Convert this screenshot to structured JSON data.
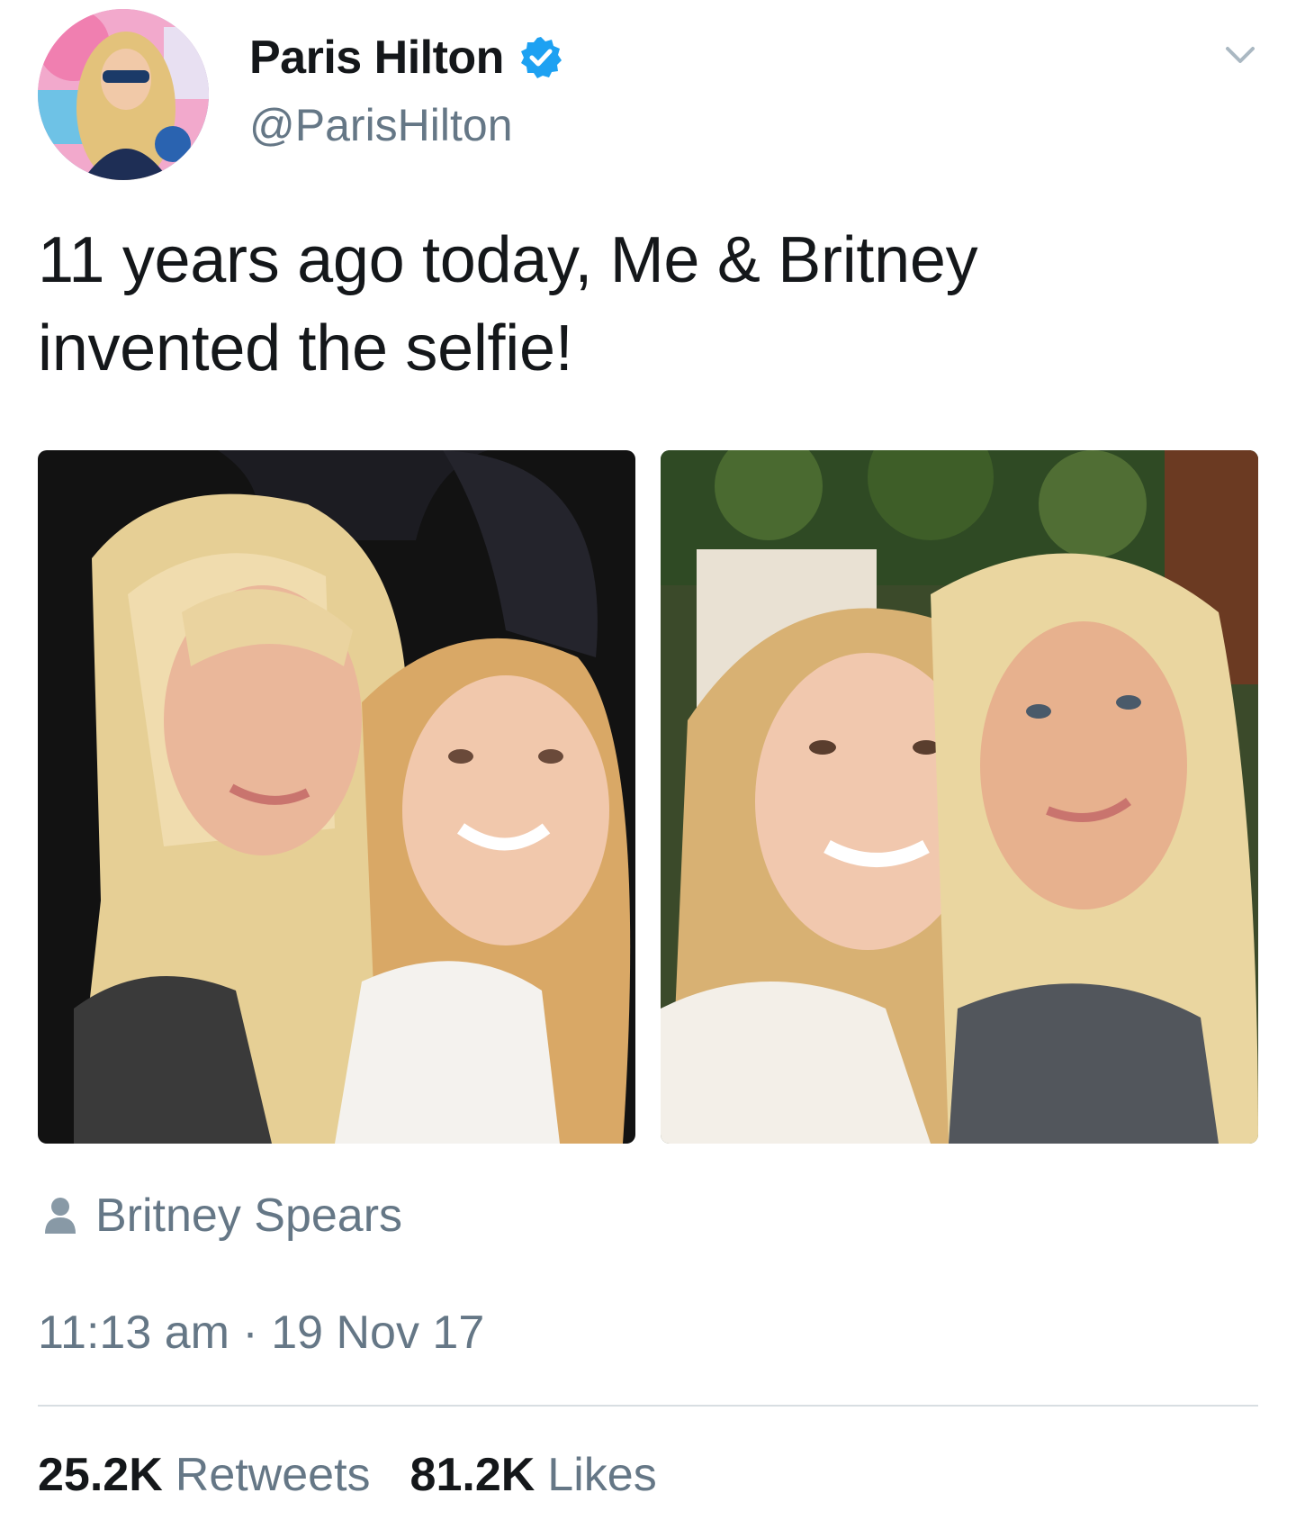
{
  "header": {
    "display_name": "Paris Hilton",
    "handle": "@ParisHilton",
    "verified": true,
    "avatar_icon": "profile-photo",
    "menu_icon": "chevron-down-icon"
  },
  "tweet": {
    "text_line1": "11 years ago today, Me & Britney",
    "text_line2": "invented the selfie!"
  },
  "photos": [
    {
      "name": "selfie-photo-1"
    },
    {
      "name": "selfie-photo-2"
    }
  ],
  "tagged": {
    "icon": "person-icon",
    "name": "Britney Spears"
  },
  "timestamp": {
    "time": "11:13 am",
    "separator": "·",
    "date": "19 Nov 17"
  },
  "stats": {
    "retweets_count": "25.2K",
    "retweets_label": "Retweets",
    "likes_count": "81.2K",
    "likes_label": "Likes"
  },
  "colors": {
    "primary_text": "#14171a",
    "secondary_text": "#657786",
    "verified_blue": "#1da1f2",
    "divider": "#d8dee2"
  }
}
